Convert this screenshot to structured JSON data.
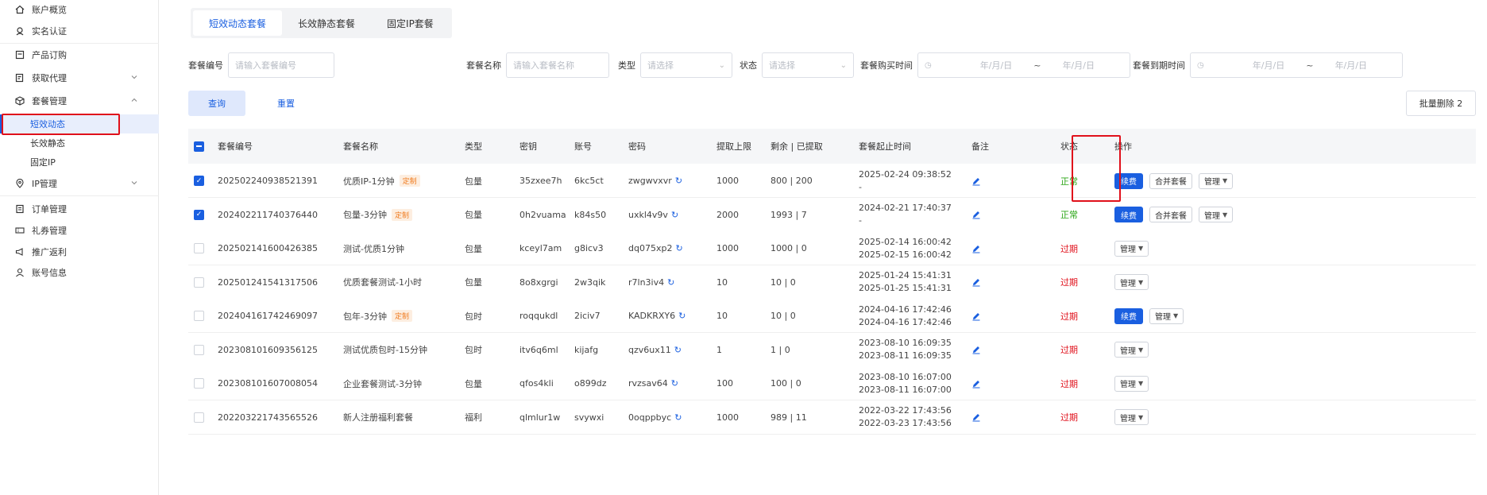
{
  "sidebar": {
    "items": [
      {
        "label": "账户概览",
        "icon": "home-icon"
      },
      {
        "label": "实名认证",
        "icon": "id-badge-icon"
      },
      {
        "label": "产品订购",
        "icon": "cart-icon"
      },
      {
        "label": "获取代理",
        "icon": "proxy-icon",
        "expandable": true
      },
      {
        "label": "套餐管理",
        "icon": "package-icon",
        "expanded": true
      },
      {
        "label": "IP管理",
        "icon": "location-icon",
        "expandable": true
      },
      {
        "label": "订单管理",
        "icon": "order-icon"
      },
      {
        "label": "礼券管理",
        "icon": "ticket-icon"
      },
      {
        "label": "推广返利",
        "icon": "megaphone-icon"
      },
      {
        "label": "账号信息",
        "icon": "user-icon"
      }
    ],
    "package_sub": [
      {
        "label": "短效动态",
        "active": true
      },
      {
        "label": "长效静态"
      },
      {
        "label": "固定IP"
      }
    ]
  },
  "tabs": [
    {
      "label": "短效动态套餐",
      "active": true
    },
    {
      "label": "长效静态套餐"
    },
    {
      "label": "固定IP套餐"
    }
  ],
  "filters": {
    "pkg_id_label": "套餐编号",
    "pkg_id_placeholder": "请输入套餐编号",
    "pkg_name_label": "套餐名称",
    "pkg_name_placeholder": "请输入套餐名称",
    "type_label": "类型",
    "type_placeholder": "请选择",
    "status_label": "状态",
    "status_placeholder": "请选择",
    "buy_time_label": "套餐购买时间",
    "expire_time_label": "套餐到期时间",
    "date_placeholder": "年/月/日",
    "range_sep": "~"
  },
  "actions": {
    "query": "查询",
    "reset": "重置",
    "batch_delete": "批量删除 2"
  },
  "table": {
    "columns": [
      "套餐编号",
      "套餐名称",
      "类型",
      "密钥",
      "账号",
      "密码",
      "提取上限",
      "剩余 | 已提取",
      "套餐起止时间",
      "备注",
      "状态",
      "操作"
    ],
    "rows": [
      {
        "id": "202502240938521391",
        "name": "优质IP-1分钟",
        "tag": "定制",
        "type": "包量",
        "key": "35zxee7h",
        "account": "6kc5ct",
        "password": "zwgwvxvr",
        "limit": "1000",
        "remain": "800 | 200",
        "start": "2025-02-24 09:38:52",
        "end": "-",
        "status": "正常",
        "status_kind": "ok",
        "checked": true,
        "renew": true,
        "merge": true
      },
      {
        "id": "202402211740376440",
        "name": "包量-3分钟",
        "tag": "定制",
        "type": "包量",
        "key": "0h2vuama",
        "account": "k84s50",
        "password": "uxkl4v9v",
        "limit": "2000",
        "remain": "1993 | 7",
        "start": "2024-02-21 17:40:37",
        "end": "-",
        "status": "正常",
        "status_kind": "ok",
        "checked": true,
        "renew": true,
        "merge": true
      },
      {
        "id": "202502141600426385",
        "name": "测试-优质1分钟",
        "tag": "",
        "type": "包量",
        "key": "kceyl7am",
        "account": "g8icv3",
        "password": "dq075xp2",
        "limit": "1000",
        "remain": "1000 | 0",
        "start": "2025-02-14 16:00:42",
        "end": "2025-02-15 16:00:42",
        "status": "过期",
        "status_kind": "exp",
        "checked": false,
        "renew": false,
        "merge": false
      },
      {
        "id": "202501241541317506",
        "name": "优质套餐测试-1小时",
        "tag": "",
        "type": "包量",
        "key": "8o8xgrgi",
        "account": "2w3qik",
        "password": "r7ln3iv4",
        "limit": "10",
        "remain": "10 | 0",
        "start": "2025-01-24 15:41:31",
        "end": "2025-01-25 15:41:31",
        "status": "过期",
        "status_kind": "exp",
        "checked": false,
        "renew": false,
        "merge": false
      },
      {
        "id": "202404161742469097",
        "name": "包年-3分钟",
        "tag": "定制",
        "type": "包时",
        "key": "roqqukdl",
        "account": "2iciv7",
        "password": "KADKRXY6",
        "limit": "10",
        "remain": "10 | 0",
        "start": "2024-04-16 17:42:46",
        "end": "2024-04-16 17:42:46",
        "status": "过期",
        "status_kind": "exp",
        "checked": false,
        "renew": true,
        "merge": false
      },
      {
        "id": "202308101609356125",
        "name": "测试优质包时-15分钟",
        "tag": "",
        "type": "包时",
        "key": "itv6q6ml",
        "account": "kijafg",
        "password": "qzv6ux11",
        "limit": "1",
        "remain": "1 | 0",
        "start": "2023-08-10 16:09:35",
        "end": "2023-08-11 16:09:35",
        "status": "过期",
        "status_kind": "exp",
        "checked": false,
        "renew": false,
        "merge": false
      },
      {
        "id": "202308101607008054",
        "name": "企业套餐测试-3分钟",
        "tag": "",
        "type": "包量",
        "key": "qfos4kli",
        "account": "o899dz",
        "password": "rvzsav64",
        "limit": "100",
        "remain": "100 | 0",
        "start": "2023-08-10 16:07:00",
        "end": "2023-08-11 16:07:00",
        "status": "过期",
        "status_kind": "exp",
        "checked": false,
        "renew": false,
        "merge": false
      },
      {
        "id": "202203221743565526",
        "name": "新人注册福利套餐",
        "tag": "",
        "type": "福利",
        "key": "qlmlur1w",
        "account": "svywxi",
        "password": "0oqppbyc",
        "limit": "1000",
        "remain": "989 | 11",
        "start": "2022-03-22 17:43:56",
        "end": "2022-03-23 17:43:56",
        "status": "过期",
        "status_kind": "exp",
        "checked": false,
        "renew": false,
        "merge": false
      }
    ],
    "op_labels": {
      "renew": "续费",
      "merge": "合并套餐",
      "manage": "管理"
    }
  },
  "colors": {
    "primary": "#1a5fe0",
    "ok": "#2aa515",
    "expired": "#e0101b",
    "tag_text": "#f07c20",
    "highlight_box": "#e0101b"
  }
}
